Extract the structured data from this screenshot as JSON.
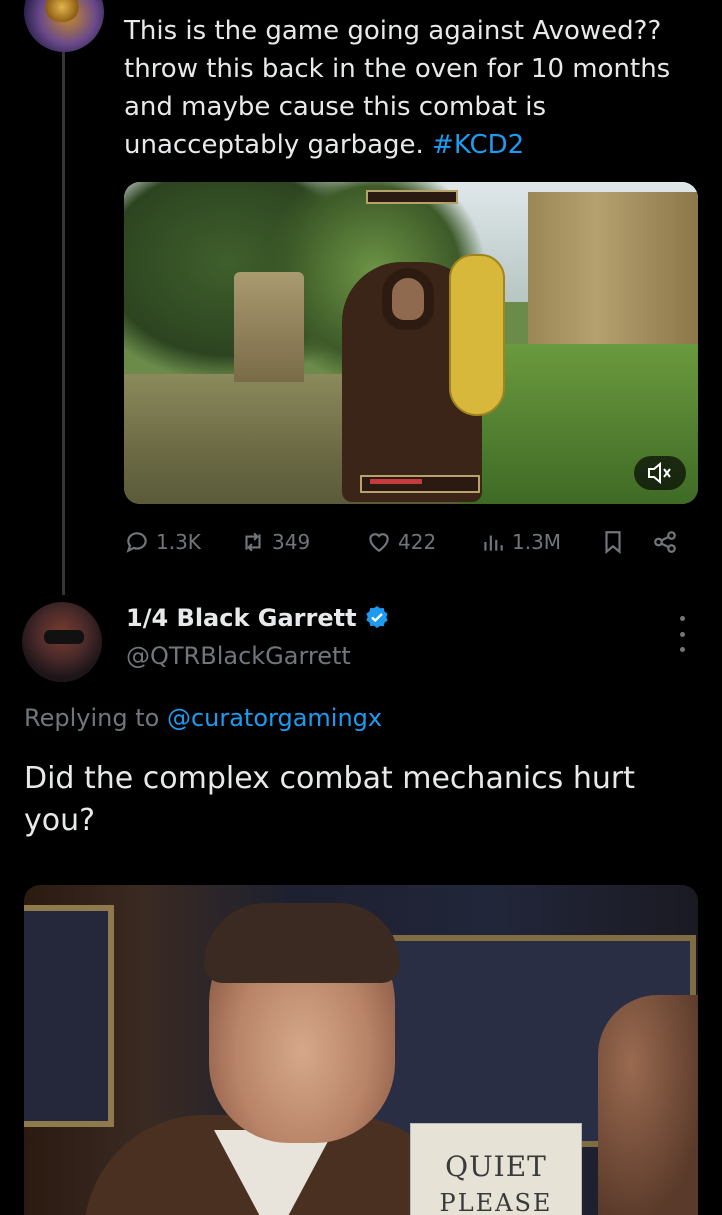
{
  "tweet1": {
    "text": "This is the game going against Avowed?? throw this back in the oven for 10 months and maybe cause this combat is unacceptably garbage.",
    "hashtag": "#KCD2",
    "media": {
      "mute_icon": "volume-mute-icon",
      "hud_label": ""
    },
    "actions": {
      "replies": "1.3K",
      "reposts": "349",
      "likes": "422",
      "views": "1.3M"
    }
  },
  "tweet2": {
    "display_name": "1/4 Black Garrett",
    "handle": "@QTRBlackGarrett",
    "replying_prefix": "Replying to",
    "replying_to": "@curatorgamingx",
    "text": "Did the complex combat mechanics hurt you?",
    "media": {
      "sign_line1": "QUIET",
      "sign_line2": "PLEASE"
    }
  },
  "colors": {
    "background": "#000000",
    "text": "#e7e9ea",
    "muted": "#71767b",
    "accent": "#1d9bf0"
  }
}
